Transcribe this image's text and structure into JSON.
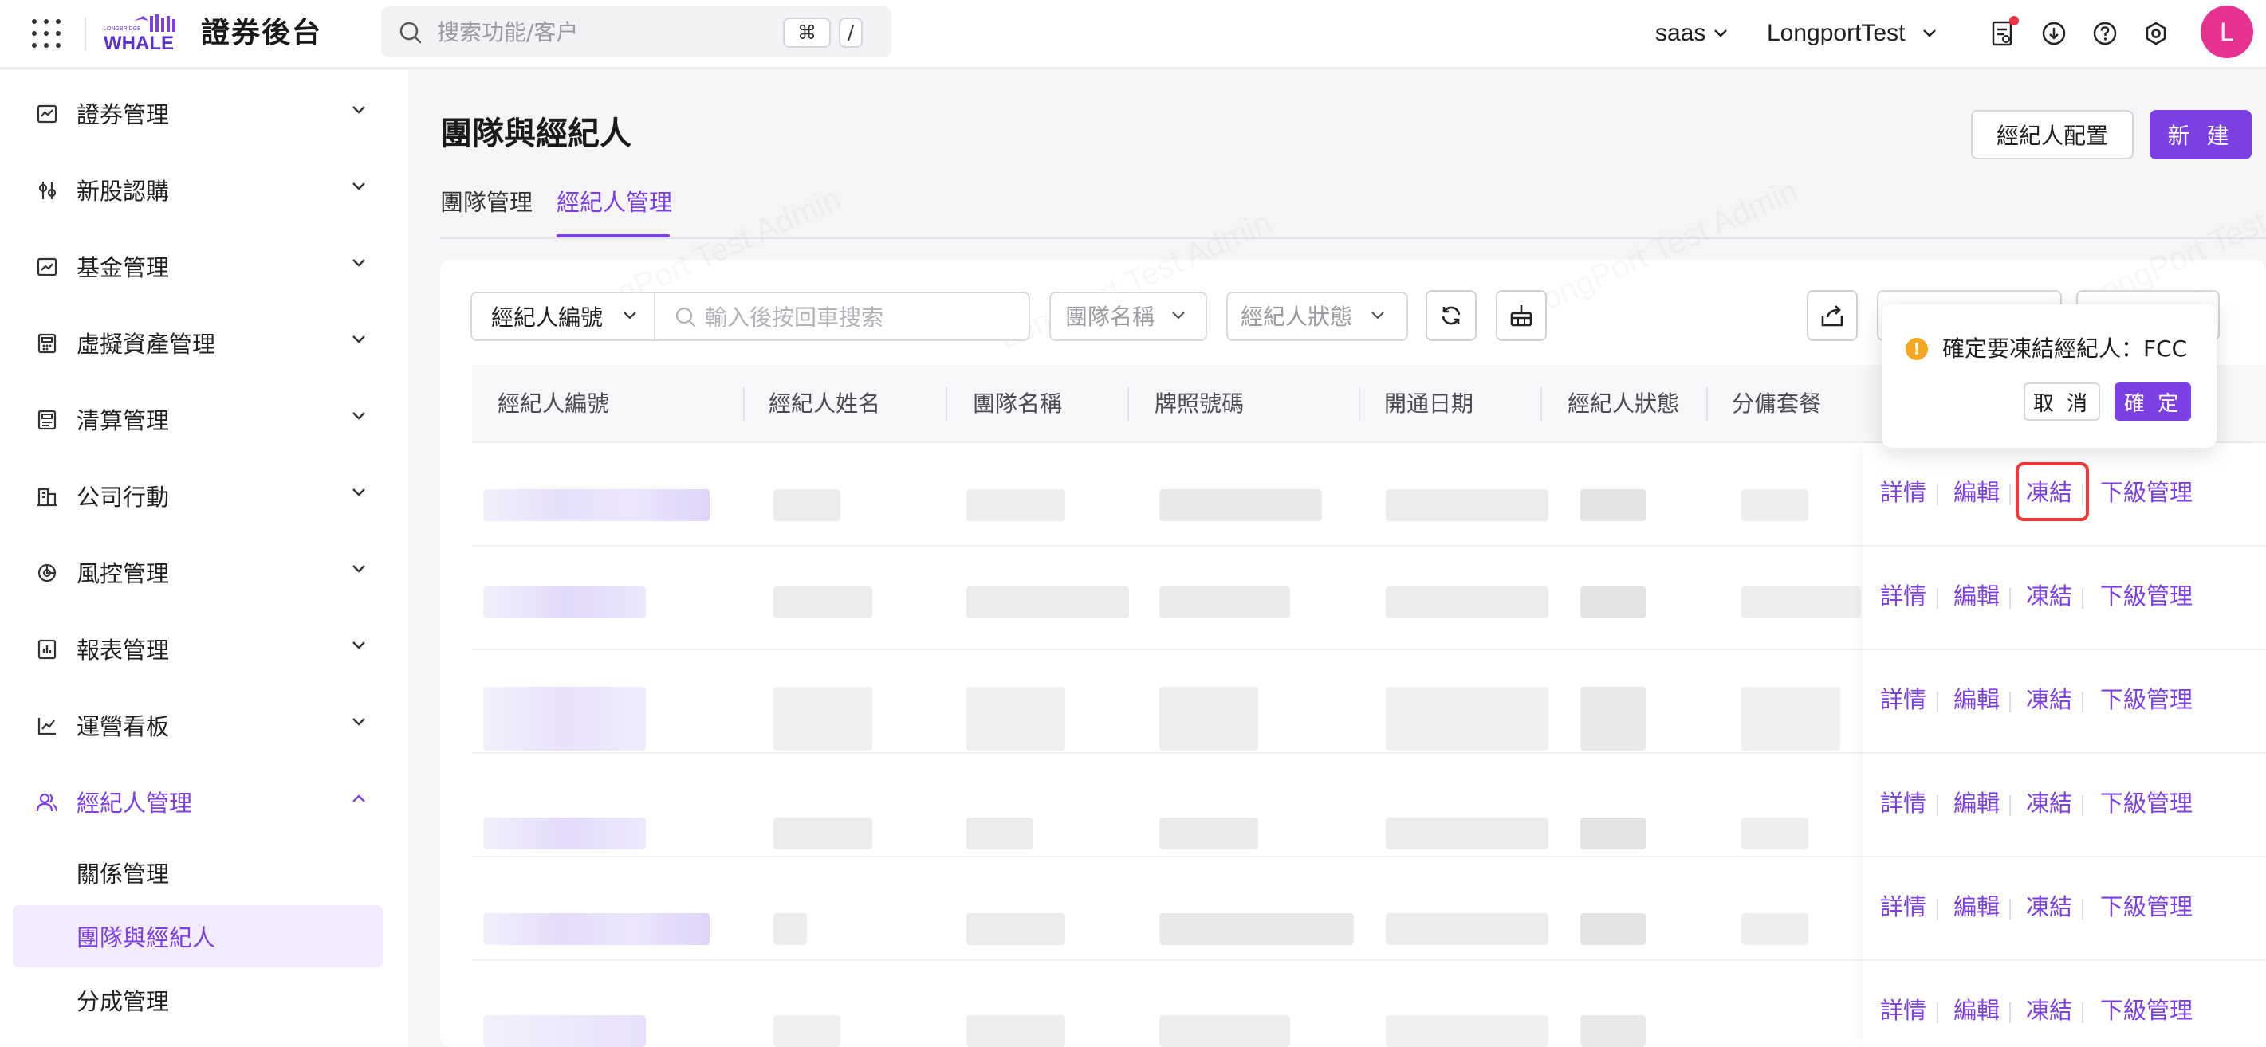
{
  "app": {
    "logo_small_text": "LONGBRIDGE",
    "logo_text": "WHALE",
    "title": "證券後台",
    "search_placeholder": "搜索功能/客户",
    "shortcut_cmd": "⌘",
    "shortcut_slash": "/",
    "tenant": "saas",
    "account": "LongportTest",
    "avatar_letter": "L",
    "accent_color": "#7b3fe4"
  },
  "sidebar": {
    "items": [
      {
        "label": "證券管理",
        "icon": "securities-icon"
      },
      {
        "label": "新股認購",
        "icon": "ipo-icon"
      },
      {
        "label": "基金管理",
        "icon": "fund-icon"
      },
      {
        "label": "虛擬資產管理",
        "icon": "virtual-asset-icon"
      },
      {
        "label": "清算管理",
        "icon": "clearing-icon"
      },
      {
        "label": "公司行動",
        "icon": "corporate-action-icon"
      },
      {
        "label": "風控管理",
        "icon": "risk-icon"
      },
      {
        "label": "報表管理",
        "icon": "report-icon"
      },
      {
        "label": "運營看板",
        "icon": "dashboard-icon"
      },
      {
        "label": "經紀人管理",
        "icon": "broker-icon",
        "expanded": true
      }
    ],
    "sub_items": [
      {
        "label": "關係管理"
      },
      {
        "label": "團隊與經紀人",
        "selected": true
      },
      {
        "label": "分成管理"
      }
    ]
  },
  "page": {
    "title": "團隊與經紀人",
    "config_button": "經紀人配置",
    "new_button": "新 建",
    "tabs": [
      {
        "label": "團隊管理"
      },
      {
        "label": "經紀人管理",
        "active": true
      }
    ]
  },
  "filters": {
    "field_select": "經紀人編號",
    "keyword_placeholder": "輸入後按回車搜索",
    "team_placeholder": "團隊名稱",
    "status_placeholder": "經紀人狀態"
  },
  "table": {
    "columns": [
      "經紀人編號",
      "經紀人姓名",
      "團隊名稱",
      "牌照號碼",
      "開通日期",
      "經紀人狀態",
      "分傭套餐"
    ],
    "actions": [
      "詳情",
      "編輯",
      "凍結",
      "下級管理"
    ],
    "row_count": 6
  },
  "popconfirm": {
    "message": "確定要凍結經紀人：FCC",
    "cancel": "取 消",
    "ok": "確 定"
  },
  "watermark": "LongPort Test Admin"
}
